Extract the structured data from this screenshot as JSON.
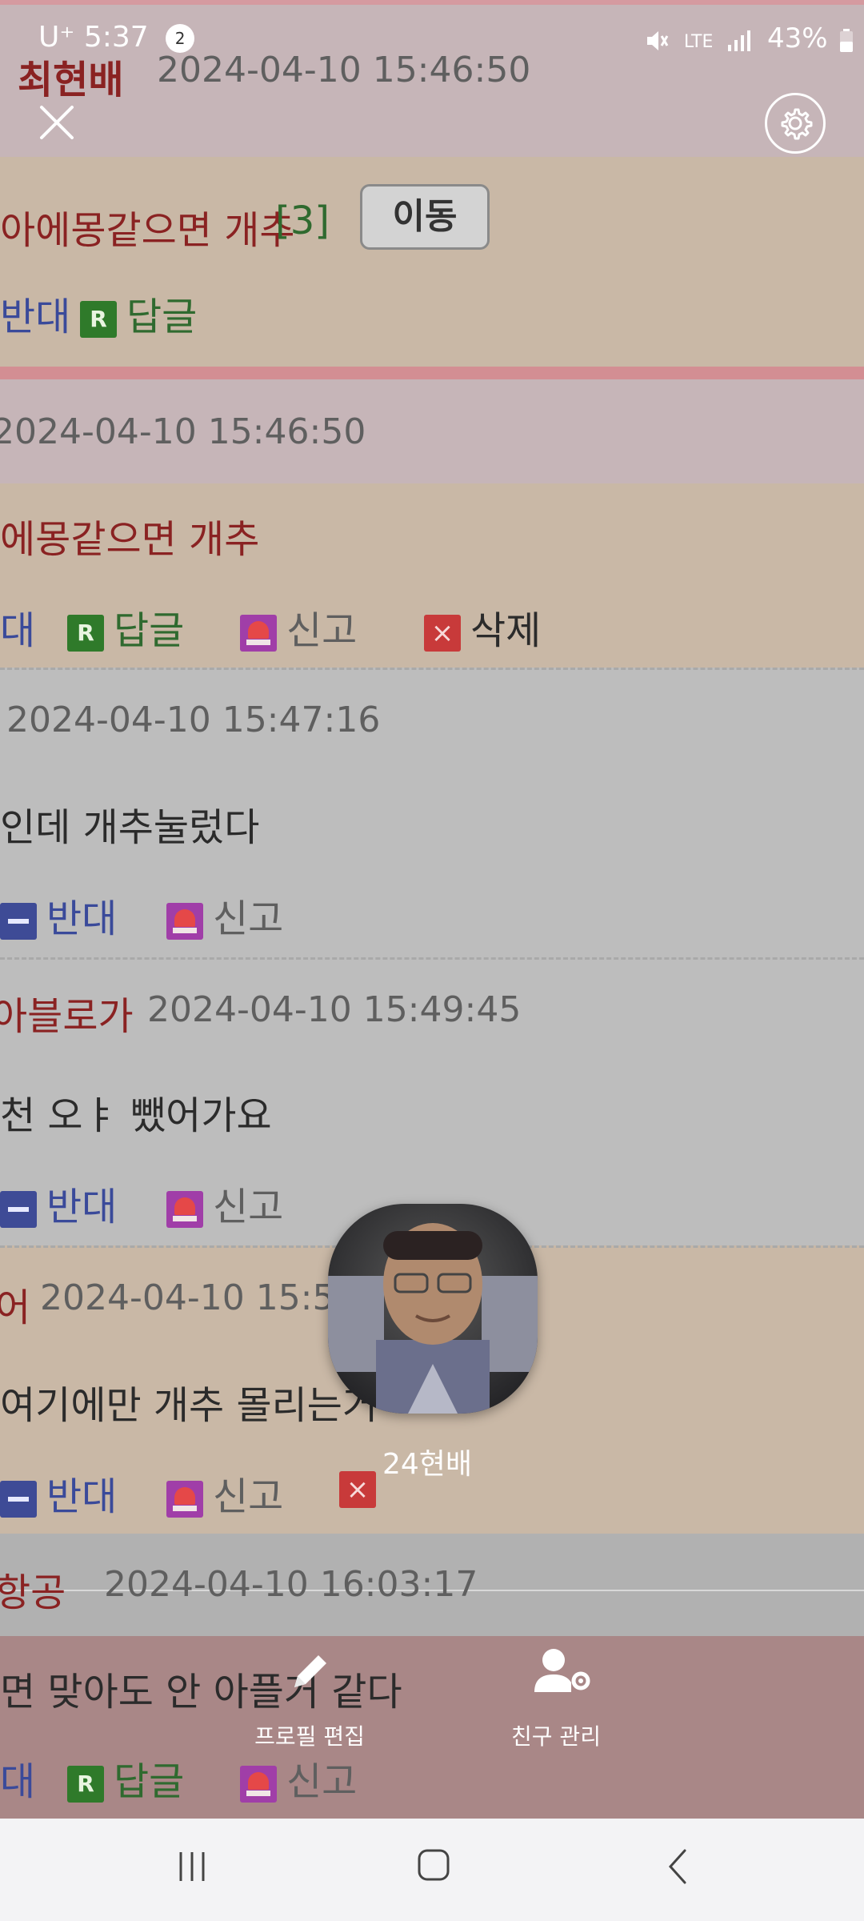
{
  "status_bar": {
    "carrier": "U⁺",
    "time": "5:37",
    "notif_count": "2",
    "network": "LTE",
    "battery": "43%"
  },
  "comments": [
    {
      "author": "최현배",
      "date": "2024-04-10 15:46:50",
      "text": "아에몽같으면 개추",
      "count": "[3]",
      "move_label": "이동",
      "actions": [
        "반대",
        "답글"
      ]
    },
    {
      "date": "2024-04-10 15:46:50",
      "text": "에몽같으면 개추",
      "actions": [
        "대",
        "답글",
        "신고",
        "삭제"
      ]
    },
    {
      "date": "2024-04-10 15:47:16",
      "text": "인데 개추눌렀다",
      "actions": [
        "반대",
        "신고"
      ]
    },
    {
      "author": "아블로가",
      "date": "2024-04-10 15:49:45",
      "text": "천 오ㅑ 뺐어가요",
      "actions": [
        "반대",
        "신고"
      ]
    },
    {
      "author": "어",
      "date": "2024-04-10 15:50",
      "text": "여기에만 개추 몰리는거",
      "actions": [
        "반대",
        "신고"
      ]
    },
    {
      "author": "항공",
      "date": "2024-04-10 16:03:17",
      "text": "면 맞아도 안 아플거 같다",
      "actions": [
        "대",
        "답글",
        "신고"
      ]
    }
  ],
  "profile": {
    "name": "24현배"
  },
  "profile_actions": {
    "edit": "프로필 편집",
    "friends": "친구 관리"
  },
  "colors": {
    "header_band": "#c6b5b8",
    "comment_tan": "#c9b8a6",
    "comment_gray": "#bdbdbd",
    "bottom_band": "#a98787"
  }
}
